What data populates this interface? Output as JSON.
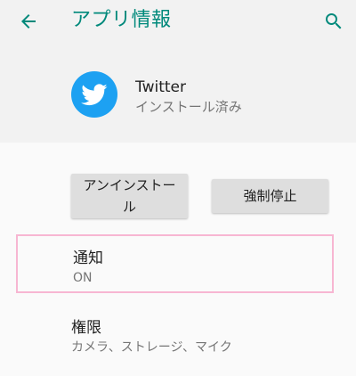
{
  "toolbar": {
    "title": "アプリ情報",
    "back_icon": "arrow-back-icon",
    "search_icon": "search-icon",
    "accent_color": "#00897b"
  },
  "app": {
    "name": "Twitter",
    "status": "インストール済み",
    "icon": "twitter-bird-icon",
    "icon_color": "#1da1f2"
  },
  "actions": {
    "uninstall_label": "アンインストール",
    "force_stop_label": "強制停止"
  },
  "preferences": {
    "notification": {
      "title": "通知",
      "summary": "ON"
    },
    "permissions": {
      "title": "権限",
      "summary": "カメラ、ストレージ、マイク"
    }
  }
}
